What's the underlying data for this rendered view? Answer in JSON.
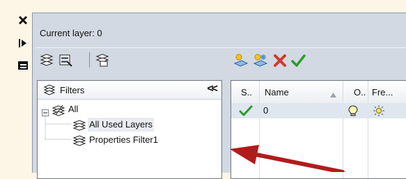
{
  "sidebar": {
    "icons": [
      "close-icon",
      "auto-hide-icon",
      "properties-icon"
    ]
  },
  "header": {
    "current_layer": "Current layer: 0"
  },
  "toolbar": {
    "left_icons": [
      "new-property-filter-icon",
      "new-group-filter-icon",
      "layer-states-manager-icon"
    ],
    "right_icons": [
      "new-layer-icon",
      "new-layer-vp-frozen-icon",
      "delete-layer-icon",
      "set-current-icon"
    ]
  },
  "filters": {
    "title": "Filters",
    "collapse_label": "<<",
    "tree": {
      "root": "All",
      "children": [
        "All Used Layers",
        "Properties Filter1"
      ]
    }
  },
  "grid": {
    "columns": [
      "S..",
      "Name",
      "O..",
      "Fre..."
    ],
    "rows": [
      {
        "name": "0"
      }
    ]
  },
  "colors": {
    "accent_arrow": "#b01c1c",
    "check": "#2e9a2e",
    "delete": "#d23a2a"
  }
}
